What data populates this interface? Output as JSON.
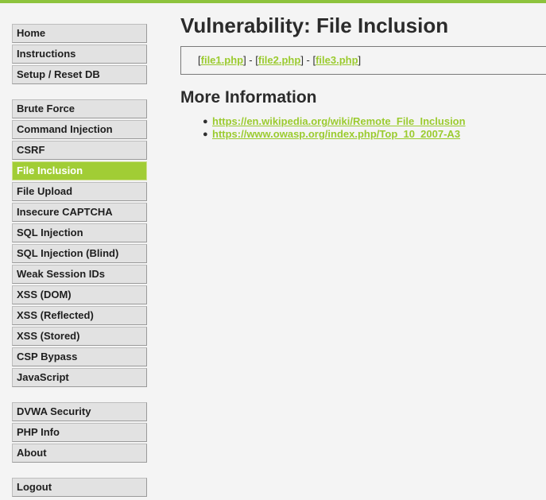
{
  "menu": {
    "group1": [
      {
        "label": "Home"
      },
      {
        "label": "Instructions"
      },
      {
        "label": "Setup / Reset DB"
      }
    ],
    "group2": [
      {
        "label": "Brute Force"
      },
      {
        "label": "Command Injection"
      },
      {
        "label": "CSRF"
      },
      {
        "label": "File Inclusion"
      },
      {
        "label": "File Upload"
      },
      {
        "label": "Insecure CAPTCHA"
      },
      {
        "label": "SQL Injection"
      },
      {
        "label": "SQL Injection (Blind)"
      },
      {
        "label": "Weak Session IDs"
      },
      {
        "label": "XSS (DOM)"
      },
      {
        "label": "XSS (Reflected)"
      },
      {
        "label": "XSS (Stored)"
      },
      {
        "label": "CSP Bypass"
      },
      {
        "label": "JavaScript"
      }
    ],
    "group3": [
      {
        "label": "DVWA Security"
      },
      {
        "label": "PHP Info"
      },
      {
        "label": "About"
      }
    ],
    "group4": [
      {
        "label": "Logout"
      }
    ],
    "selected": "File Inclusion"
  },
  "page": {
    "title": "Vulnerability: File Inclusion",
    "files": {
      "open_bracket": "[",
      "separator": "] - [",
      "close_bracket": "]",
      "file1": "file1.php",
      "file2": "file2.php",
      "file3": "file3.php"
    },
    "more_info_heading": "More Information",
    "links": [
      "https://en.wikipedia.org/wiki/Remote_File_Inclusion",
      "https://www.owasp.org/index.php/Top_10_2007-A3"
    ]
  },
  "colors": {
    "accent_green": "#a1cd35",
    "link_green": "#9bcb2f",
    "menu_bg": "#e2e2e2",
    "page_bg": "#f4f4f4"
  }
}
